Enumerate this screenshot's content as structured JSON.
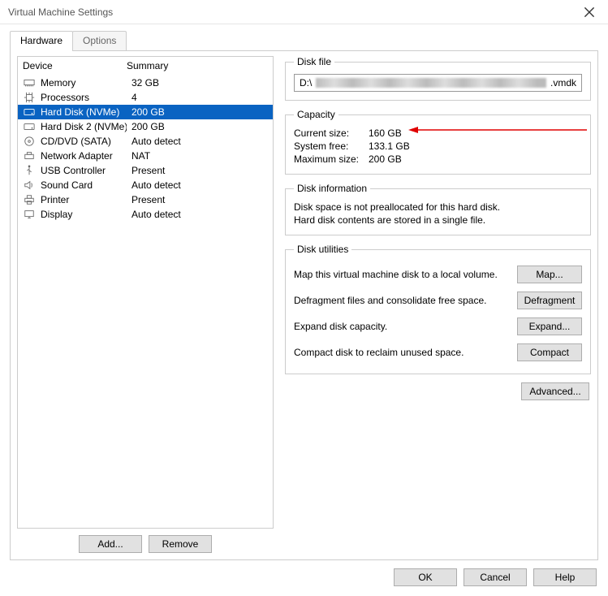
{
  "window": {
    "title": "Virtual Machine Settings"
  },
  "tabs": {
    "hardware": "Hardware",
    "options": "Options"
  },
  "columns": {
    "device": "Device",
    "summary": "Summary"
  },
  "devices": [
    {
      "icon": "memory-icon",
      "name": "Memory",
      "summary": "32 GB"
    },
    {
      "icon": "cpu-icon",
      "name": "Processors",
      "summary": "4"
    },
    {
      "icon": "disk-icon",
      "name": "Hard Disk (NVMe)",
      "summary": "200 GB",
      "selected": true
    },
    {
      "icon": "disk-icon",
      "name": "Hard Disk 2 (NVMe)",
      "summary": "200 GB"
    },
    {
      "icon": "cd-icon",
      "name": "CD/DVD (SATA)",
      "summary": "Auto detect"
    },
    {
      "icon": "network-icon",
      "name": "Network Adapter",
      "summary": "NAT"
    },
    {
      "icon": "usb-icon",
      "name": "USB Controller",
      "summary": "Present"
    },
    {
      "icon": "sound-icon",
      "name": "Sound Card",
      "summary": "Auto detect"
    },
    {
      "icon": "printer-icon",
      "name": "Printer",
      "summary": "Present"
    },
    {
      "icon": "display-icon",
      "name": "Display",
      "summary": "Auto detect"
    }
  ],
  "left_buttons": {
    "add": "Add...",
    "remove": "Remove"
  },
  "diskfile": {
    "legend": "Disk file",
    "prefix": "D:\\",
    "suffix": ".vmdk"
  },
  "capacity": {
    "legend": "Capacity",
    "current_label": "Current size:",
    "current_value": "160 GB",
    "free_label": "System free:",
    "free_value": "133.1 GB",
    "max_label": "Maximum size:",
    "max_value": "200 GB"
  },
  "diskinfo": {
    "legend": "Disk information",
    "line1": "Disk space is not preallocated for this hard disk.",
    "line2": "Hard disk contents are stored in a single file."
  },
  "utilities": {
    "legend": "Disk utilities",
    "map_text": "Map this virtual machine disk to a local volume.",
    "map_btn": "Map...",
    "defrag_text": "Defragment files and consolidate free space.",
    "defrag_btn": "Defragment",
    "expand_text": "Expand disk capacity.",
    "expand_btn": "Expand...",
    "compact_text": "Compact disk to reclaim unused space.",
    "compact_btn": "Compact"
  },
  "advanced_btn": "Advanced...",
  "bottom": {
    "ok": "OK",
    "cancel": "Cancel",
    "help": "Help"
  }
}
